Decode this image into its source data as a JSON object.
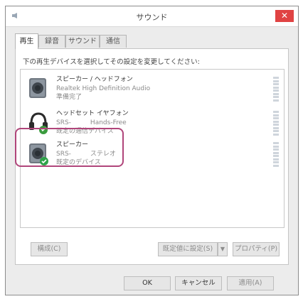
{
  "window": {
    "title": "サウンド",
    "close_label": "✕"
  },
  "tabs": [
    {
      "label": "再生",
      "active": true
    },
    {
      "label": "録音",
      "active": false
    },
    {
      "label": "サウンド",
      "active": false
    },
    {
      "label": "通信",
      "active": false
    }
  ],
  "instruction": "下の再生デバイスを選択してその設定を変更してください:",
  "devices": [
    {
      "name": "スピーカー / ヘッドフォン",
      "description": "Realtek High Definition Audio",
      "status": "準備完了",
      "icon": "speaker-icon"
    },
    {
      "name": "ヘッドセット イヤフォン",
      "description": "SRS-　　　Hands-Free",
      "status": "既定の通信デバイス",
      "icon": "headset-icon"
    },
    {
      "name": "スピーカー",
      "description": "SRS-　　　ステレオ",
      "status": "既定のデバイス",
      "icon": "speaker-icon"
    }
  ],
  "buttons": {
    "configure": "構成(C)",
    "set_default": "既定値に設定(S)",
    "properties": "プロパティ(P)",
    "ok": "OK",
    "cancel": "キャンセル",
    "apply": "適用(A)"
  },
  "colors": {
    "close": "#e04343",
    "highlight": "#b0457a",
    "check": "#2fa34a",
    "phone": "#3a9b3e"
  }
}
